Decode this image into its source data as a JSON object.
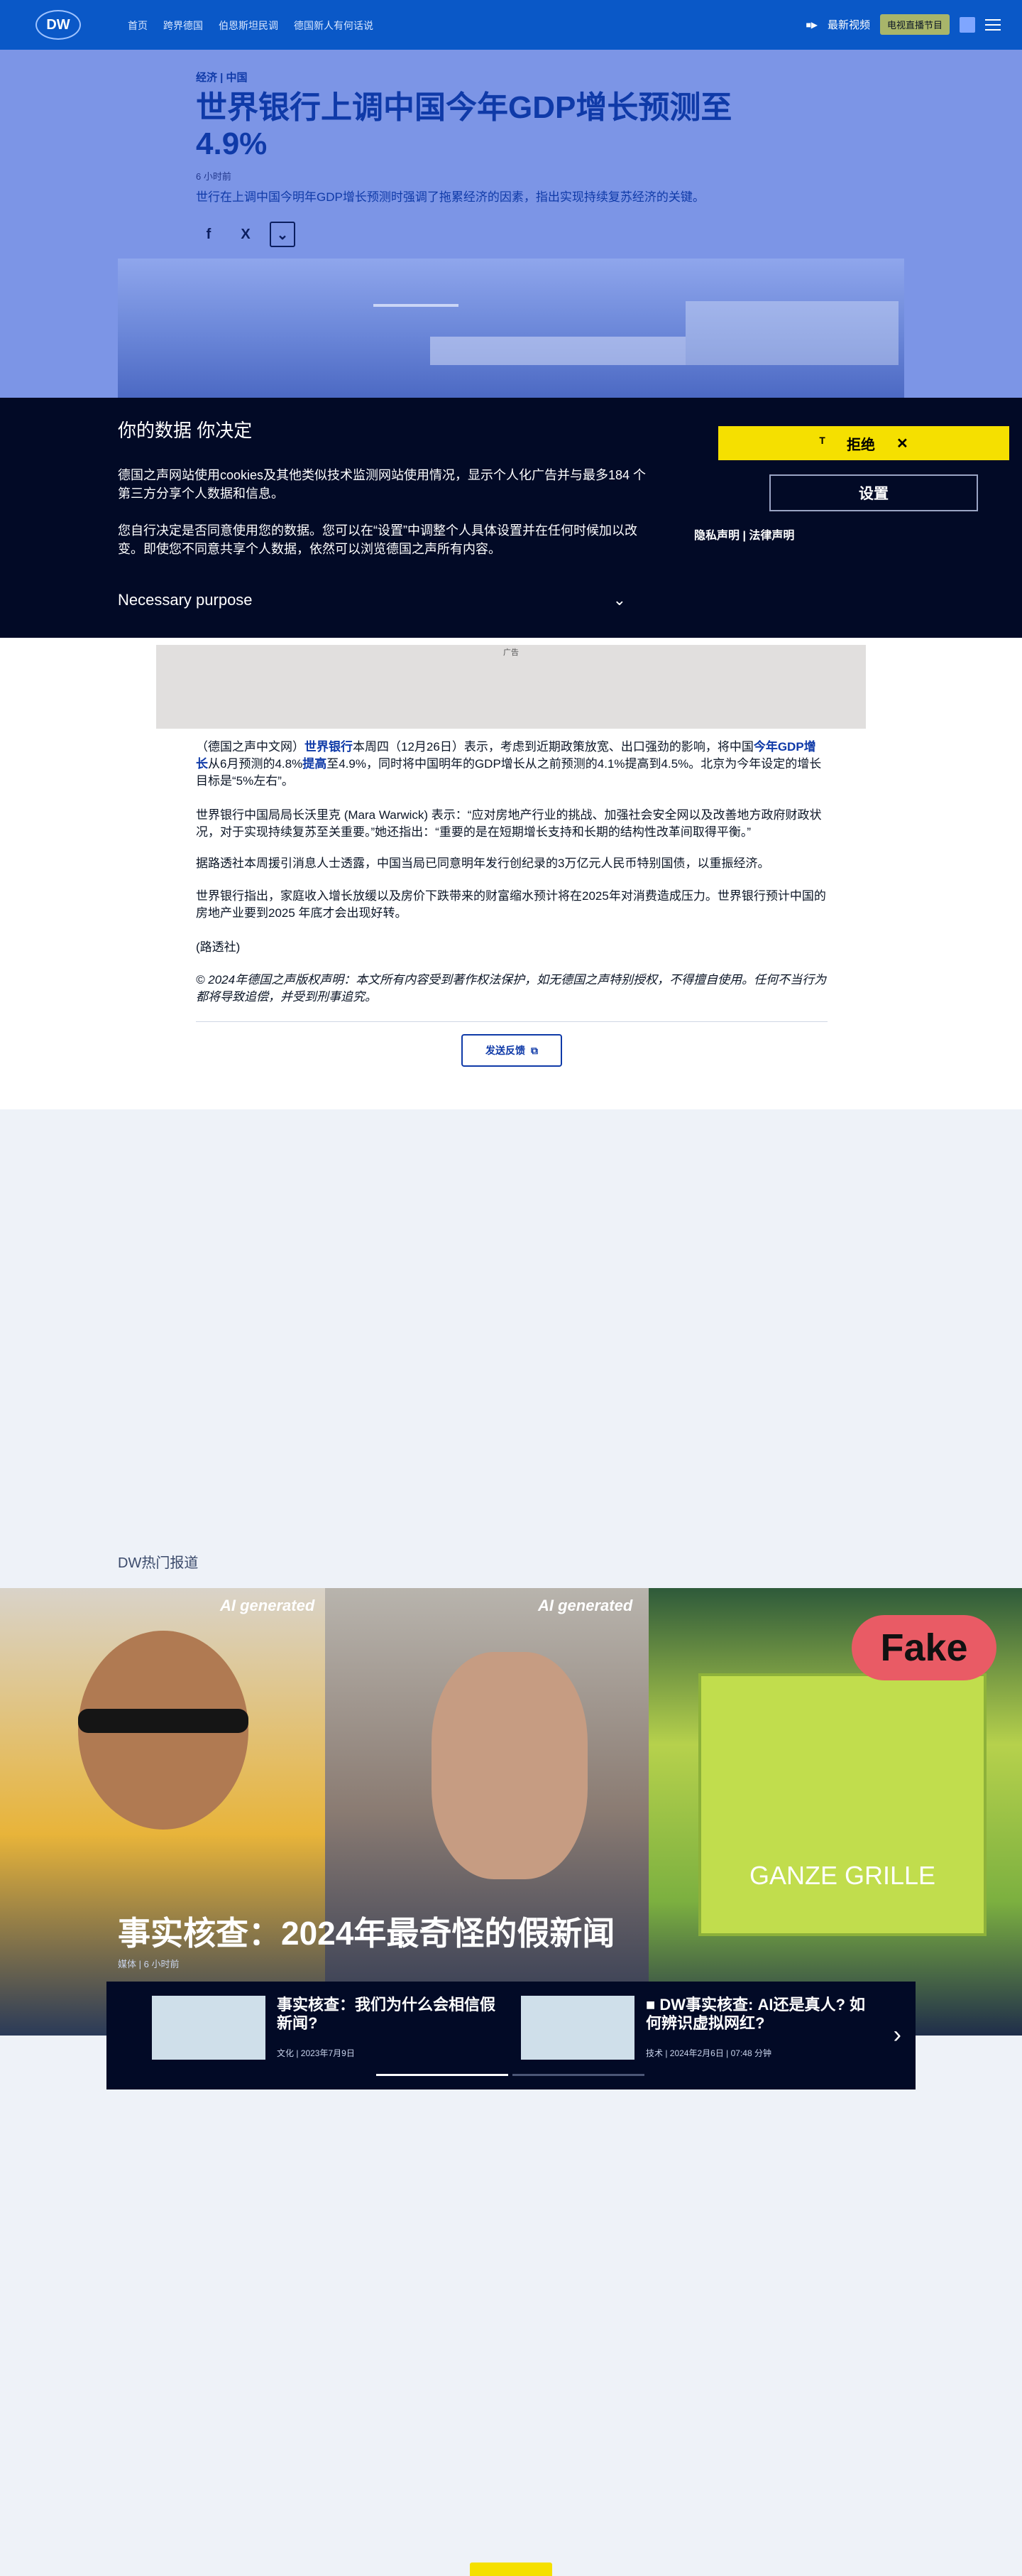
{
  "nav": {
    "logo": "DW",
    "links": [
      "首页",
      "跨界德国",
      "伯恩斯坦民调",
      "德国新人有何话说"
    ],
    "video_label": "最新视频",
    "live_label": "电视直播节目"
  },
  "article": {
    "crumb": "经济 | 中国",
    "title": "世界银行上调中国今年GDP增长预测至4.9%",
    "time": "6 小时前",
    "lead": "世行在上调中国今明年GDP增长预测时强调了拖累经济的因素，指出实现持续复苏经济的关键。"
  },
  "consent": {
    "heading": "你的数据 你决定",
    "p1": "德国之声网站使用cookies及其他类似技术监测网站使用情况，显示个人化广告并与最多184 个第三方分享个人数据和信息。",
    "p2": "您自行决定是否同意使用您的数据。您可以在“设置”中调整个人具体设置并在任何时候加以改变。即使您不同意共享个人数据，依然可以浏览德国之声所有内容。",
    "purpose": "Necessary purpose",
    "reject": "拒绝",
    "settings": "设置",
    "privacy": "隐私声明",
    "legal": "法律声明"
  },
  "body": {
    "ad_label": "广告",
    "para1_a": "（德国之声中文网）",
    "para1_link1": "世界银行",
    "para1_b": "本周四（12月26日）表示，考虑到近期政策放宽、出口强劲的影响，将中国",
    "para1_link2": "今年GDP增长",
    "para1_c": "从6月预测的4.8%",
    "para1_link3": "提高",
    "para1_d": "至4.9%，同时将中国明年的GDP增长从之前预测的4.1%提高到4.5%。北京为今年设定的增长目标是“5%左右”。",
    "para2": "世界银行中国局局长沃里克 (Mara Warwick) 表示：“应对房地产行业的挑战、加强社会安全网以及改善地方政府财政状况，对于实现持续复苏至关重要。”她还指出：“重要的是在短期增长支持和长期的结构性改革间取得平衡。”",
    "para3": "据路透社本周援引消息人士透露，中国当局已同意明年发行创纪录的3万亿元人民币特别国债，以重振经济。",
    "para4": "世界银行指出，家庭收入增长放缓以及房价下跌带来的财富缩水预计将在2025年对消费造成压力。世界银行预计中国的房地产业要到2025 年底才会出现好转。",
    "para5": "(路透社)",
    "copyright": "© 2024年德国之声版权声明：本文所有内容受到著作权法保护，如无德国之声特别授权，不得擅自使用。任何不当行为都将导致追偿，并受到刑事追究。",
    "feedback": "发送反馈"
  },
  "hot": {
    "section_title": "DW热门报道",
    "ai_tag": "AI generated",
    "fake_tag": "Fake",
    "pack_text": "GANZE GRILLE",
    "headline": "事实核查：2024年最奇怪的假新闻",
    "meta": "媒体 | 6 小时前",
    "cards": [
      {
        "title": "事实核查：我们为什么会相信假新闻?",
        "meta": "文化 | 2023年7月9日"
      },
      {
        "title": "DW事实核查: AI还是真人? 如何辨识虚拟网红?",
        "meta": "技术 | 2024年2月6日 | 07:48 分钟"
      }
    ]
  }
}
